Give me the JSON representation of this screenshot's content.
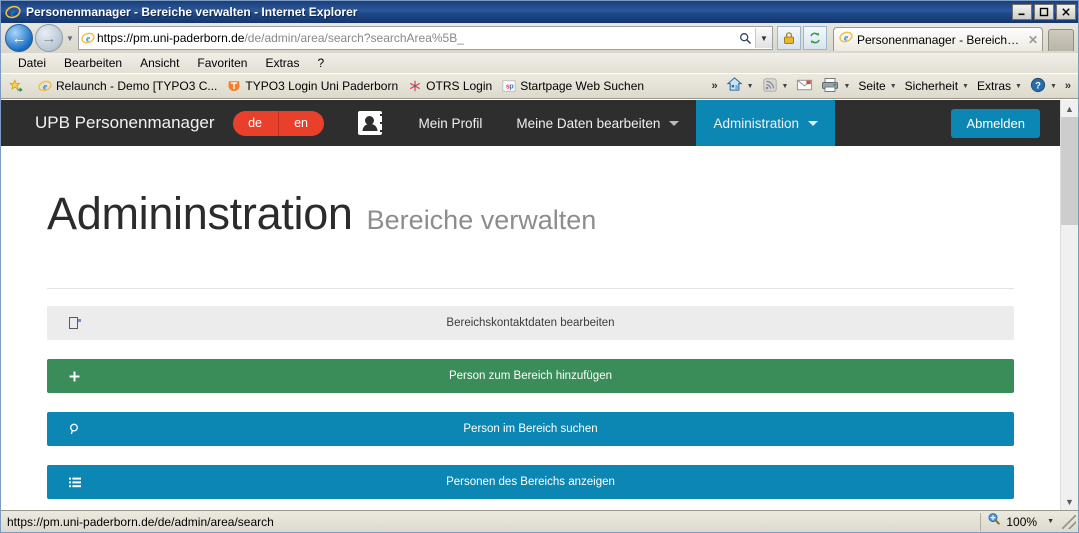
{
  "browser": {
    "title": "Personenmanager - Bereiche verwalten - Internet Explorer",
    "window_controls": {
      "minimize": "_",
      "maximize": "☐",
      "close": "✕"
    },
    "address": {
      "scheme": "https://",
      "host": "pm.uni-paderborn.de",
      "path": "/de/admin/area/search?searchArea%5B_",
      "full": "https://pm.uni-paderborn.de/de/admin/area/search?searchArea%5B_"
    },
    "tab": {
      "label": "Personenmanager - Bereiche...",
      "close": "✕"
    },
    "menu": [
      {
        "label": "Datei",
        "accel": "D"
      },
      {
        "label": "Bearbeiten",
        "accel": "B"
      },
      {
        "label": "Ansicht",
        "accel": "A"
      },
      {
        "label": "Favoriten",
        "accel": "F"
      },
      {
        "label": "Extras",
        "accel": "x"
      },
      {
        "label": "?",
        "accel": ""
      }
    ],
    "favorites": [
      {
        "label": "Relaunch - Demo [TYPO3 C...",
        "icon": "ie-icon"
      },
      {
        "label": "TYPO3 Login Uni Paderborn",
        "icon": "typo3-icon"
      },
      {
        "label": "OTRS Login",
        "icon": "otrs-icon"
      },
      {
        "label": "Startpage Web Suchen",
        "icon": "startpage-icon"
      }
    ],
    "favorites_overflow": "»",
    "command_bar": [
      {
        "label": "Seite",
        "icon": "page-icon"
      },
      {
        "label": "Sicherheit",
        "icon": "shield-icon"
      },
      {
        "label": "Extras",
        "icon": "tools-icon"
      }
    ],
    "command_overflow": "»",
    "status": {
      "url": "https://pm.uni-paderborn.de/de/admin/area/search",
      "zoom": "100%"
    }
  },
  "app": {
    "brand": "UPB Personenmanager",
    "languages": [
      {
        "code": "de",
        "active": true
      },
      {
        "code": "en",
        "active": false
      }
    ],
    "nav": [
      {
        "label": "Mein Profil",
        "has_caret": false,
        "active": false
      },
      {
        "label": "Meine Daten bearbeiten",
        "has_caret": true,
        "active": false
      },
      {
        "label": "Administration",
        "has_caret": true,
        "active": true
      }
    ],
    "logout": "Abmelden",
    "heading": {
      "title": "Admininstration",
      "subtitle": "Bereiche verwalten"
    },
    "actions": [
      {
        "label": "Bereichskontaktdaten bearbeiten",
        "icon": "edit-icon",
        "style": "grey"
      },
      {
        "label": "Person zum Bereich hinzufügen",
        "icon": "plus-icon",
        "style": "green"
      },
      {
        "label": "Person im Bereich suchen",
        "icon": "search-icon",
        "style": "blue"
      },
      {
        "label": "Personen des Bereichs anzeigen",
        "icon": "list-icon",
        "style": "blue"
      }
    ]
  },
  "colors": {
    "navbar": "#2e2e2e",
    "accent_blue": "#0c87b3",
    "accent_green": "#3a8c58",
    "accent_red": "#e8402a",
    "bar_grey": "#ececec"
  }
}
